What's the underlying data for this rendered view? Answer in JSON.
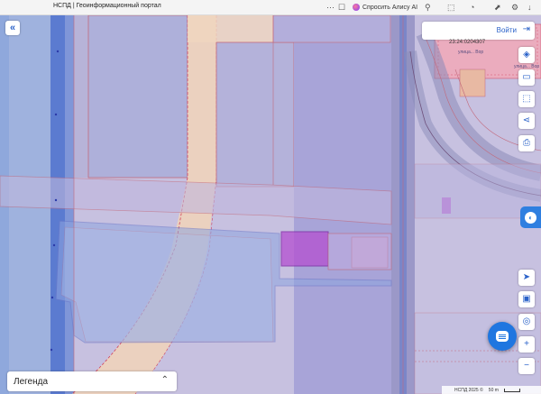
{
  "browser": {
    "tab_title": "НСПД | Геоинформационный портал",
    "assistant_label": "Спросить Алису AI",
    "icons": [
      "bookmark-icon",
      "extensions-icon",
      "download-icon",
      "profile-icon",
      "settings-icon",
      "menu-icon"
    ]
  },
  "map": {
    "login_label": "Войти",
    "parcel_label": "23:24:0204307",
    "street_label_1": "улица... Вор",
    "street_label_2": "улица... Вор",
    "legend_label": "Легенда",
    "attribution": "НСПД 2025 ©",
    "scale_label": "50 m",
    "colors": {
      "accent": "#2a62c9",
      "parcel_fill": "#8a7fd6",
      "zone_fill": "#f1d3b8",
      "selected_parcel": "#b44fd1"
    }
  },
  "controls": {
    "right_toolbar": [
      "layers-icon",
      "ruler-icon",
      "select-area-icon",
      "share-icon",
      "print-icon"
    ],
    "lower_toolbar": [
      "locate-icon",
      "screen-icon",
      "geolocation-icon"
    ],
    "zoom_in": "+",
    "zoom_out": "−"
  }
}
